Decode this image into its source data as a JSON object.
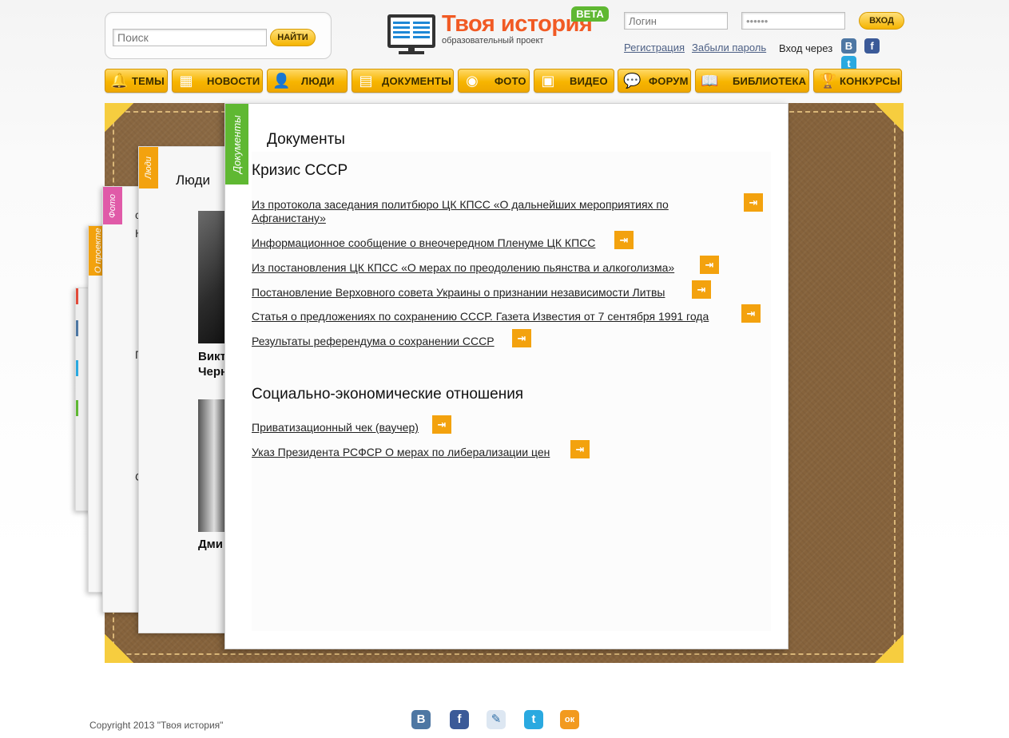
{
  "header": {
    "search_placeholder": "Поиск",
    "search_button": "НАЙТИ",
    "logo_title": "Твоя история",
    "logo_subtitle": "образовательный проект",
    "beta": "BETA",
    "login_placeholder": "Логин",
    "password_value": "••••••",
    "login_button": "ВХОД",
    "register_link": "Регистрация",
    "forgot_link": "Забыли пароль",
    "via_label": "Вход через",
    "social": [
      {
        "icon": "vk-icon",
        "glyph": "B"
      },
      {
        "icon": "facebook-icon",
        "glyph": "f"
      },
      {
        "icon": "twitter-icon",
        "glyph": "t"
      }
    ]
  },
  "nav": [
    {
      "label": "ТЕМЫ",
      "icon": "bell-icon",
      "glyph": "🔔"
    },
    {
      "label": "НОВОСТИ",
      "icon": "calendar-icon",
      "glyph": "▦"
    },
    {
      "label": "ЛЮДИ",
      "icon": "person-icon",
      "glyph": "👤"
    },
    {
      "label": "ДОКУМЕНТЫ",
      "icon": "document-icon",
      "glyph": "▤"
    },
    {
      "label": "ФОТО",
      "icon": "camera-icon",
      "glyph": "◉"
    },
    {
      "label": "ВИДЕО",
      "icon": "film-icon",
      "glyph": "▣"
    },
    {
      "label": "ФОРУМ",
      "icon": "speech-bubble-icon",
      "glyph": "💬"
    },
    {
      "label": "БИБЛИОТЕКА",
      "icon": "book-icon",
      "glyph": "📖"
    },
    {
      "label": "КОНКУРСЫ",
      "icon": "trophy-icon",
      "glyph": "🏆"
    }
  ],
  "cards": {
    "about_tab": "О проекте",
    "photo_tab": "Фото",
    "people_tab": "Люди",
    "people_title": "Люди",
    "person1_line1": "Викт",
    "person1_line2": "Черн",
    "person2_line1": "Дми",
    "photo_frag": [
      "с",
      "К",
      "П",
      "С"
    ]
  },
  "documents": {
    "tab": "Документы",
    "title": "Документы",
    "sections": [
      {
        "heading": "Кризис СССР",
        "links": [
          "Из протокола заседания политбюро ЦК КПСС «О дальнейших мероприятиях по Афганистану»",
          "Информационное сообщение о внеочередном Пленуме ЦК КПСС",
          "Из постановления ЦК КПСС «О мерах по преодолению пьянства и алкоголизма»",
          "Постановление Верховного совета Украины о признании независимости Литвы",
          "Статья о предложениях по сохранению СССР. Газета Известия от 7 сентября 1991 года",
          "Результаты референдума о сохранении СССР"
        ]
      },
      {
        "heading": "Социально-экономические отношения",
        "links": [
          "Приватизационный чек (ваучер)",
          "Указ Президента РСФСР О мерах по либерализации цен"
        ]
      }
    ],
    "open_glyph": "⇥"
  },
  "footer": {
    "copyright": "Copyright 2013 \"Твоя история\"",
    "social": [
      {
        "icon": "vk-icon",
        "glyph": "B"
      },
      {
        "icon": "facebook-icon",
        "glyph": "f"
      },
      {
        "icon": "livejournal-icon",
        "glyph": "✎"
      },
      {
        "icon": "twitter-icon",
        "glyph": "t"
      },
      {
        "icon": "odnoklassniki-icon",
        "glyph": "ок"
      }
    ]
  },
  "colors": {
    "accent_orange": "#f15a24",
    "nav_yellow": "#f7b500",
    "beta_green": "#5fb832",
    "leather": "#86633c"
  }
}
